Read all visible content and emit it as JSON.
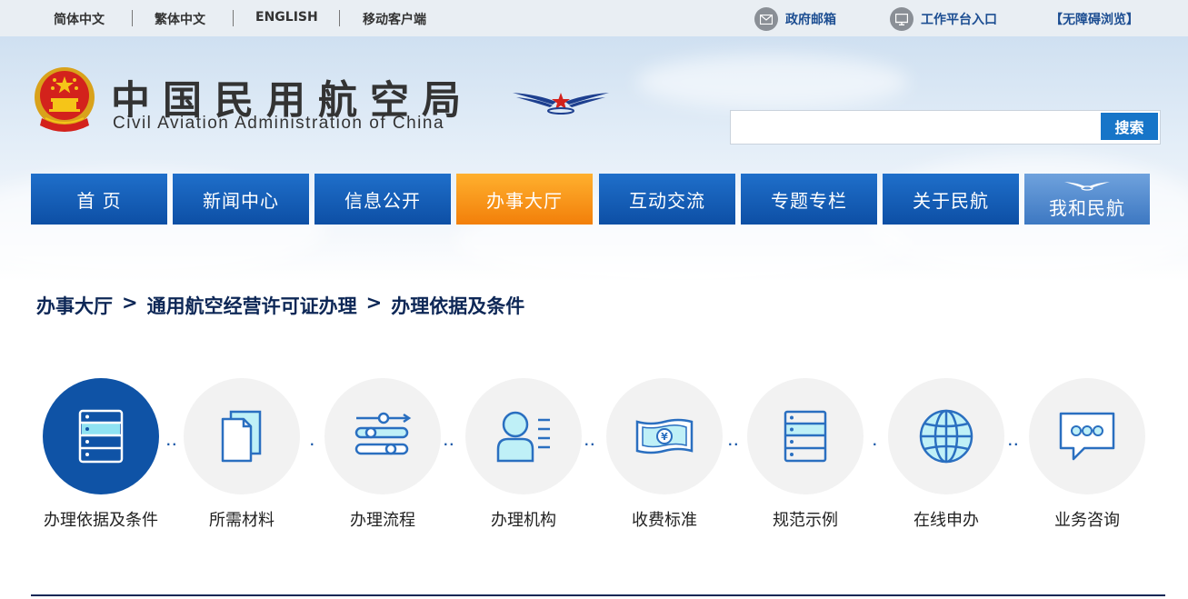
{
  "topbar": {
    "languages": [
      "简体中文",
      "繁体中文",
      "ENGLISH",
      "移动客户端"
    ],
    "mail_label": "政府邮箱",
    "mail_icon": "envelope-icon",
    "workbench_label": "工作平台入口",
    "workbench_icon": "monitor-icon",
    "accessibility_label": "【无障碍浏览】"
  },
  "header": {
    "title_cn": "中国民用航空局",
    "title_en": "Civil Aviation Administration of China",
    "emblem_icon": "national-emblem-icon",
    "logo_icon": "caac-wings-logo-icon"
  },
  "search": {
    "placeholder": "",
    "button_label": "搜索"
  },
  "nav": {
    "items": [
      "首 页",
      "新闻中心",
      "信息公开",
      "办事大厅",
      "互动交流",
      "专题专栏",
      "关于民航",
      "我和民航"
    ],
    "active_item": "办事大厅"
  },
  "breadcrumb": {
    "items": [
      "办事大厅",
      "通用航空经营许可证办理",
      "办理依据及条件"
    ],
    "separator": ">"
  },
  "services": {
    "active": "办理依据及条件",
    "items": [
      {
        "label": "办理依据及条件",
        "icon": "server-stack-icon"
      },
      {
        "label": "所需材料",
        "icon": "documents-icon"
      },
      {
        "label": "办理流程",
        "icon": "flow-sliders-icon"
      },
      {
        "label": "办理机构",
        "icon": "person-card-icon"
      },
      {
        "label": "收费标准",
        "icon": "banknote-icon"
      },
      {
        "label": "规范示例",
        "icon": "server-stack-icon"
      },
      {
        "label": "在线申办",
        "icon": "globe-icon"
      },
      {
        "label": "业务咨询",
        "icon": "chat-bubble-icon"
      }
    ]
  },
  "colors": {
    "nav_blue": "#0d4fa5",
    "nav_active_orange": "#f27f0a",
    "icon_accent": "#2a6fc0",
    "active_circle": "#0f53a6",
    "breadcrumb_text": "#0d2756"
  }
}
